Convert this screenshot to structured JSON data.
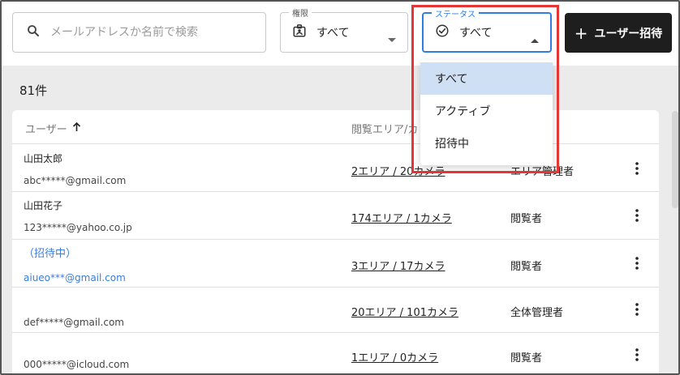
{
  "search": {
    "placeholder": "メールアドレスか名前で検索"
  },
  "filters": {
    "role": {
      "label": "権限",
      "value": "すべて"
    },
    "status": {
      "label": "ステータス",
      "value": "すべて"
    }
  },
  "invite_button": {
    "label": "ユーザー招待"
  },
  "count": "81件",
  "table": {
    "headers": {
      "user": "ユーザー",
      "area": "閲覧エリア/カ"
    },
    "rows": [
      {
        "name": "山田太郎",
        "email": "abc*****@gmail.com",
        "area": "2エリア / 20カメラ",
        "role": "エリア管理者"
      },
      {
        "name": "山田花子",
        "email": "123*****@yahoo.co.jp",
        "area": "174エリア / 1カメラ",
        "role": "閲覧者"
      },
      {
        "name": "（招待中）",
        "email": "aiueo***@gmail.com",
        "area": "3エリア / 17カメラ",
        "role": "閲覧者"
      },
      {
        "name": "",
        "email": "def*****@gmail.com",
        "area": "20エリア / 101カメラ",
        "role": "全体管理者"
      },
      {
        "name": "",
        "email": "000*****@icloud.com",
        "area": "1エリア / 0カメラ",
        "role": "閲覧者"
      }
    ]
  },
  "status_menu": {
    "options": [
      "すべて",
      "アクティブ",
      "招待中"
    ],
    "selected": "すべて"
  },
  "colors": {
    "accent": "#2e7de0",
    "highlight": "#e53535",
    "invited": "#3b7ddd",
    "button": "#1e1e1e"
  }
}
